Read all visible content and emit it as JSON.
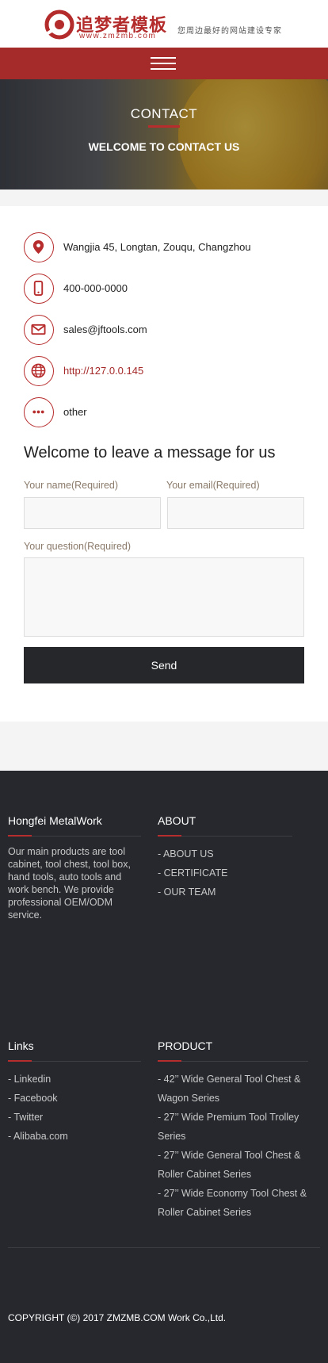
{
  "header": {
    "brand": "追梦者模板",
    "brand_sub": "www.zmzmb.com",
    "tagline": "您周边最好的网站建设专家"
  },
  "hero": {
    "title": "CONTACT",
    "subtitle": "WELCOME TO CONTACT US"
  },
  "contact": {
    "items": [
      {
        "icon": "location-pin-icon",
        "text": "Wangjia 45, Longtan, Zouqu, Changzhou"
      },
      {
        "icon": "mobile-phone-icon",
        "text": "400-000-0000"
      },
      {
        "icon": "mail-icon",
        "text": "sales@jftools.com"
      },
      {
        "icon": "globe-icon",
        "text": "http://127.0.0.145"
      },
      {
        "icon": "more-dots-icon",
        "text": "other"
      }
    ]
  },
  "form": {
    "title": "Welcome to leave a message for us",
    "name_label": "Your name(Required)",
    "email_label": "Your email(Required)",
    "question_label": "Your question(Required)",
    "name_value": "",
    "email_value": "",
    "question_value": "",
    "send_label": "Send"
  },
  "footer": {
    "company": {
      "title": "Hongfei MetalWork",
      "description": "Our main products are tool cabinet, tool chest, tool box, hand tools, auto tools and work bench. We provide professional OEM/ODM service."
    },
    "about": {
      "title": "ABOUT",
      "items": [
        "- ABOUT US",
        "- CERTIFICATE",
        "- OUR TEAM"
      ]
    },
    "links": {
      "title": "Links",
      "items": [
        "- Linkedin",
        "- Facebook",
        "- Twitter",
        "- Alibaba.com"
      ]
    },
    "product": {
      "title": "PRODUCT",
      "items": [
        "- 42’’ Wide General Tool Chest & Wagon Series",
        "- 27’’ Wide Premium Tool Trolley Series",
        "- 27’’ Wide General Tool Chest & Roller Cabinet Series",
        "- 27’’ Wide Economy Tool Chest & Roller Cabinet Series"
      ]
    },
    "copyright": "COPYRIGHT (©) 2017 ZMZMB.COM Work Co.,Ltd."
  },
  "colors": {
    "accent": "#b72d2d",
    "nav": "#a52a2a",
    "footer_bg": "#26282d",
    "button_bg": "#26272b"
  }
}
